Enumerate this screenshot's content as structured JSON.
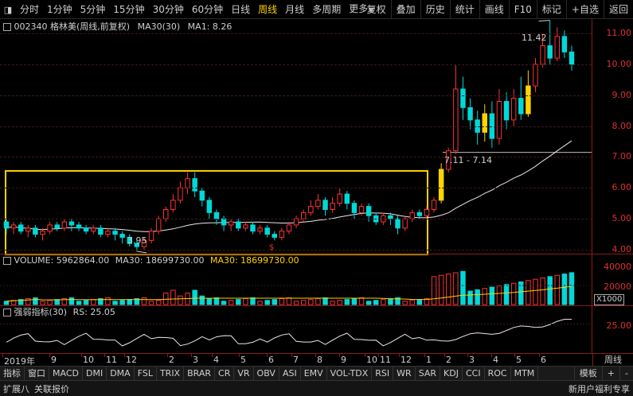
{
  "toolbar": {
    "timeframes": [
      "分时",
      "1分钟",
      "5分钟",
      "15分钟",
      "30分钟",
      "60分钟",
      "日线",
      "周线",
      "月线",
      "多周期",
      "更多"
    ],
    "active": "周线",
    "right_buttons": [
      "复权",
      "叠加",
      "历史",
      "统计",
      "画线",
      "F10",
      "标记",
      "+自选",
      "返回"
    ]
  },
  "main_legend": {
    "stock": "002340 格林美(周线,前复权)",
    "ma": "MA30(30)",
    "ma1": "MA1: 8.26"
  },
  "price_axis": {
    "labels": [
      "11.00",
      "10.00",
      "9.00",
      "8.00",
      "7.00",
      "6.00",
      "5.00",
      "4.00"
    ],
    "values": [
      11,
      10,
      9,
      8,
      7,
      6,
      5,
      4
    ],
    "min_value": 4.0,
    "max_value": 11.0
  },
  "annotations": {
    "high": "11.42",
    "low": "3.95",
    "range": "7.11 - 7.14",
    "dollar": "$"
  },
  "volume_legend": {
    "label": "VOLUME: 5962864.00",
    "ma30a": "MA30: 18699730.00",
    "ma30b": "MA30: 18699730.00"
  },
  "volume_axis": {
    "labels": [
      "40000",
      "20000"
    ],
    "unit": "X1000"
  },
  "rs_legend": {
    "label": "强弱指标(30)",
    "value": "RS: 25.05"
  },
  "rs_axis": {
    "labels": [
      "25.00"
    ]
  },
  "date_axis": {
    "labels": [
      "2019年",
      "9",
      "10",
      "11",
      "12",
      "2",
      "3",
      "4",
      "5",
      "6",
      "7",
      "8",
      "9",
      "10",
      "11",
      "12",
      "1",
      "2",
      "3",
      "4",
      "5",
      "6"
    ],
    "period": "周线"
  },
  "indicator_tabs": [
    "指标",
    "窗口",
    "MACD",
    "DMI",
    "DMA",
    "FSL",
    "TRIX",
    "BRAR",
    "CR",
    "VR",
    "OBV",
    "ASI",
    "EMV",
    "VOL-TDX",
    "RSI",
    "WR",
    "SAR",
    "KDJ",
    "CCI",
    "ROC",
    "MTM"
  ],
  "indicator_right": [
    "模板",
    "+",
    "-"
  ],
  "status": {
    "left": [
      "扩展八",
      "关联报价"
    ],
    "right": "新用户福利专享"
  },
  "chart_data": {
    "type": "candlestick",
    "title": "002340 格林美(周线,前复权)",
    "ylim": [
      4.0,
      11.0
    ],
    "candles": [
      [
        4.9,
        4.7,
        5.0,
        4.5
      ],
      [
        4.7,
        4.8,
        4.9,
        4.5
      ],
      [
        4.8,
        4.6,
        4.9,
        4.5
      ],
      [
        4.6,
        4.7,
        4.8,
        4.4
      ],
      [
        4.7,
        4.5,
        4.8,
        4.4
      ],
      [
        4.5,
        4.6,
        4.7,
        4.3
      ],
      [
        4.6,
        4.8,
        4.9,
        4.5
      ],
      [
        4.8,
        4.7,
        4.9,
        4.6
      ],
      [
        4.7,
        4.9,
        5.0,
        4.6
      ],
      [
        4.9,
        4.8,
        5.0,
        4.6
      ],
      [
        4.8,
        4.7,
        4.9,
        4.6
      ],
      [
        4.7,
        4.6,
        4.8,
        4.5
      ],
      [
        4.6,
        4.7,
        4.8,
        4.5
      ],
      [
        4.7,
        4.5,
        4.8,
        4.4
      ],
      [
        4.5,
        4.6,
        4.7,
        4.4
      ],
      [
        4.6,
        4.5,
        4.7,
        4.3
      ],
      [
        4.5,
        4.4,
        4.6,
        4.2
      ],
      [
        4.4,
        4.2,
        4.5,
        4.1
      ],
      [
        4.2,
        4.1,
        4.3,
        3.95
      ],
      [
        4.1,
        4.3,
        4.4,
        4.0
      ],
      [
        4.3,
        4.6,
        4.7,
        4.2
      ],
      [
        4.6,
        5.0,
        5.1,
        4.5
      ],
      [
        5.0,
        5.3,
        5.4,
        4.9
      ],
      [
        5.3,
        5.6,
        5.8,
        5.2
      ],
      [
        5.6,
        6.0,
        6.2,
        5.5
      ],
      [
        6.0,
        6.3,
        6.5,
        5.8
      ],
      [
        6.3,
        5.9,
        6.5,
        5.7
      ],
      [
        5.9,
        5.6,
        6.0,
        5.4
      ],
      [
        5.6,
        5.2,
        5.7,
        5.0
      ],
      [
        5.2,
        5.0,
        5.3,
        4.8
      ],
      [
        5.0,
        4.8,
        5.1,
        4.6
      ],
      [
        4.8,
        4.9,
        5.0,
        4.6
      ],
      [
        4.9,
        4.7,
        5.0,
        4.6
      ],
      [
        4.7,
        4.8,
        4.9,
        4.6
      ],
      [
        4.8,
        4.6,
        4.9,
        4.5
      ],
      [
        4.6,
        4.7,
        4.8,
        4.5
      ],
      [
        4.7,
        4.5,
        4.8,
        4.4
      ],
      [
        4.5,
        4.4,
        4.6,
        4.3
      ],
      [
        4.4,
        4.6,
        4.7,
        4.3
      ],
      [
        4.6,
        4.8,
        4.9,
        4.5
      ],
      [
        4.8,
        5.0,
        5.1,
        4.7
      ],
      [
        5.0,
        5.2,
        5.3,
        4.9
      ],
      [
        5.2,
        5.4,
        5.6,
        5.1
      ],
      [
        5.4,
        5.6,
        5.8,
        5.3
      ],
      [
        5.6,
        5.3,
        5.7,
        5.1
      ],
      [
        5.3,
        5.5,
        5.7,
        5.2
      ],
      [
        5.5,
        5.8,
        6.0,
        5.4
      ],
      [
        5.8,
        5.5,
        5.9,
        5.3
      ],
      [
        5.5,
        5.2,
        5.6,
        5.0
      ],
      [
        5.2,
        5.4,
        5.5,
        5.1
      ],
      [
        5.4,
        5.1,
        5.5,
        4.9
      ],
      [
        5.1,
        4.9,
        5.2,
        4.8
      ],
      [
        4.9,
        5.1,
        5.2,
        4.8
      ],
      [
        5.1,
        5.0,
        5.2,
        4.8
      ],
      [
        5.0,
        4.7,
        5.1,
        4.5
      ],
      [
        4.7,
        5.0,
        5.1,
        4.6
      ],
      [
        5.0,
        5.2,
        5.3,
        4.9
      ],
      [
        5.2,
        5.1,
        5.3,
        5.0
      ],
      [
        5.1,
        5.3,
        5.4,
        5.0
      ],
      [
        5.3,
        5.6,
        5.7,
        5.2
      ],
      [
        5.6,
        6.6,
        6.8,
        5.5
      ],
      [
        6.6,
        7.2,
        7.3,
        6.5
      ],
      [
        7.2,
        9.2,
        10.0,
        7.1
      ],
      [
        9.2,
        8.6,
        9.6,
        8.2
      ],
      [
        8.6,
        8.2,
        8.9,
        7.9
      ],
      [
        8.2,
        7.8,
        8.5,
        7.4
      ],
      [
        7.8,
        8.4,
        8.7,
        7.5
      ],
      [
        8.4,
        7.6,
        8.8,
        7.3
      ],
      [
        7.6,
        8.8,
        9.2,
        7.4
      ],
      [
        8.8,
        8.2,
        9.1,
        7.9
      ],
      [
        8.2,
        8.9,
        9.2,
        8.0
      ],
      [
        8.9,
        8.4,
        9.6,
        8.2
      ],
      [
        8.4,
        9.3,
        9.8,
        8.3
      ],
      [
        9.3,
        10.0,
        10.2,
        9.1
      ],
      [
        10.0,
        10.6,
        11.0,
        9.9
      ],
      [
        10.6,
        10.2,
        11.42,
        10.0
      ],
      [
        10.2,
        10.9,
        11.2,
        10.1
      ],
      [
        10.9,
        10.4,
        11.1,
        10.2
      ],
      [
        10.4,
        10.0,
        10.6,
        9.8
      ]
    ],
    "volume_ylim": [
      0,
      45000
    ]
  }
}
